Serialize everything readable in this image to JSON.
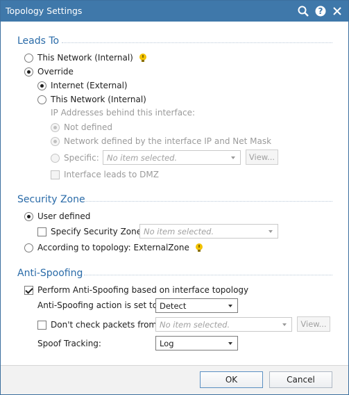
{
  "window": {
    "title": "Topology Settings"
  },
  "titlebar_icons": [
    "search-icon",
    "help-icon",
    "close-icon"
  ],
  "leads_to": {
    "header": "Leads To",
    "this_network": "This Network (Internal)",
    "override": "Override",
    "internet_external": "Internet (External)",
    "override_this_network": "This Network (Internal)",
    "ip_behind_label": "IP Addresses behind this interface:",
    "not_defined": "Not defined",
    "network_defined": "Network defined by the interface IP and Net Mask",
    "specific": "Specific:",
    "specific_value": "No item selected.",
    "view_button": "View...",
    "leads_to_dmz": "Interface leads to DMZ"
  },
  "security_zone": {
    "header": "Security Zone",
    "user_defined": "User defined",
    "specify_zone": "Specify Security Zone:",
    "zone_value": "No item selected.",
    "according_to_topology": "According to topology: ExternalZone"
  },
  "anti_spoofing": {
    "header": "Anti-Spoofing",
    "perform": "Perform Anti-Spoofing based on interface topology",
    "action_label": "Anti-Spoofing action is set to",
    "action_value": "Detect",
    "dont_check": "Don't check packets from:",
    "dont_check_value": "No item selected.",
    "view_button": "View...",
    "spoof_tracking_label": "Spoof Tracking:",
    "spoof_tracking_value": "Log"
  },
  "footer": {
    "ok": "OK",
    "cancel": "Cancel"
  },
  "colors": {
    "titlebar": "#3f78aa",
    "section_header": "#2a6ba8",
    "bulb": "#f2c200"
  }
}
